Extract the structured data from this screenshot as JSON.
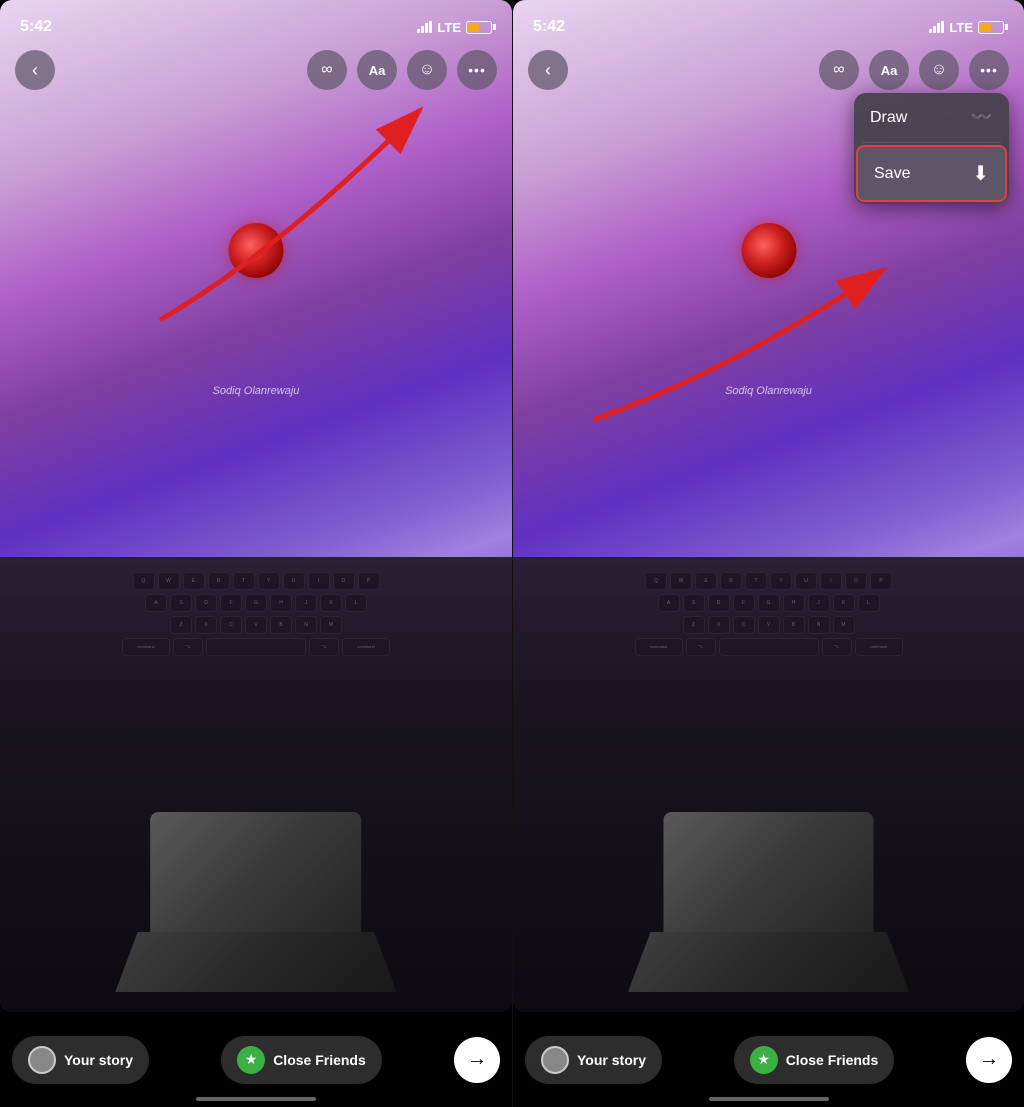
{
  "screens": [
    {
      "id": "left",
      "statusBar": {
        "time": "5:42",
        "lte": "LTE"
      },
      "toolbar": {
        "backLabel": "‹",
        "infinityLabel": "∞",
        "textLabel": "Aa",
        "stickerLabel": "☺",
        "moreLabel": "•••"
      },
      "storyText": "Sodiq Olanrewaju",
      "bottomBar": {
        "yourStoryLabel": "Your story",
        "closeFriendsLabel": "Close Friends",
        "shareArrow": "→"
      }
    },
    {
      "id": "right",
      "statusBar": {
        "time": "5:42",
        "lte": "LTE"
      },
      "toolbar": {
        "backLabel": "‹",
        "infinityLabel": "∞",
        "textLabel": "Aa",
        "stickerLabel": "☺",
        "moreLabel": "•••"
      },
      "storyText": "Sodiq Olanrewaju",
      "dropdown": {
        "drawLabel": "Draw",
        "drawIcon": "〰",
        "saveLabel": "Save",
        "saveIcon": "⬇"
      },
      "bottomBar": {
        "yourStoryLabel": "Your story",
        "closeFriendsLabel": "Close Friends",
        "shareArrow": "→"
      }
    }
  ]
}
